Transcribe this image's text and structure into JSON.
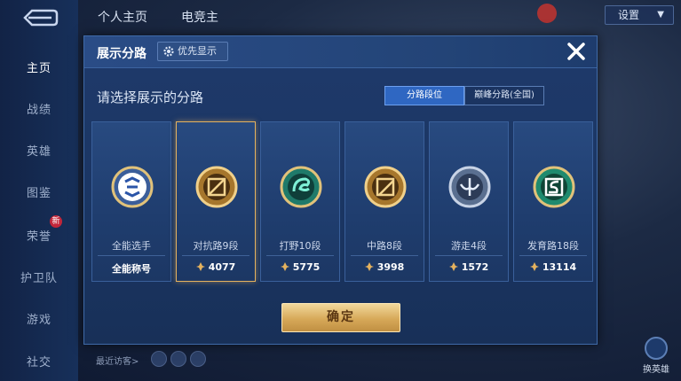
{
  "sidebar": {
    "items": [
      {
        "label": "主页"
      },
      {
        "label": "战绩"
      },
      {
        "label": "英雄"
      },
      {
        "label": "图鉴"
      },
      {
        "label": "荣誉"
      },
      {
        "label": "护卫队"
      },
      {
        "label": "游戏"
      },
      {
        "label": "社交"
      }
    ],
    "badge": "新"
  },
  "topbar": {
    "tabs": [
      {
        "label": "个人主页"
      },
      {
        "label": "电竞主"
      }
    ],
    "settings_label": "设置"
  },
  "dialog": {
    "title": "展示分路",
    "priority_label": "优先显示",
    "subtitle": "请选择展示的分路",
    "segments": [
      {
        "label": "分路段位",
        "active": true
      },
      {
        "label": "巅峰分路(全国)",
        "active": false
      }
    ],
    "cards": [
      {
        "name": "全能选手",
        "score": "全能称号",
        "selected": false,
        "icon": "all-round-emblem-icon"
      },
      {
        "name": "对抗路9段",
        "score": "4077",
        "selected": true,
        "icon": "clash-lane-emblem-icon"
      },
      {
        "name": "打野10段",
        "score": "5775",
        "selected": false,
        "icon": "jungle-emblem-icon"
      },
      {
        "name": "中路8段",
        "score": "3998",
        "selected": false,
        "icon": "mid-lane-emblem-icon"
      },
      {
        "name": "游走4段",
        "score": "1572",
        "selected": false,
        "icon": "roam-emblem-icon"
      },
      {
        "name": "发育路18段",
        "score": "13114",
        "selected": false,
        "icon": "farm-lane-emblem-icon"
      }
    ],
    "confirm_label": "确定"
  },
  "footer": {
    "visitors_label": "最近访客>"
  },
  "right_controls": {
    "bottom_label": "换英雄"
  },
  "colors": {
    "accent_gold": "#e5b25e",
    "segment_active": "#2f67c2",
    "panel_bg": "#1f3a6b"
  }
}
